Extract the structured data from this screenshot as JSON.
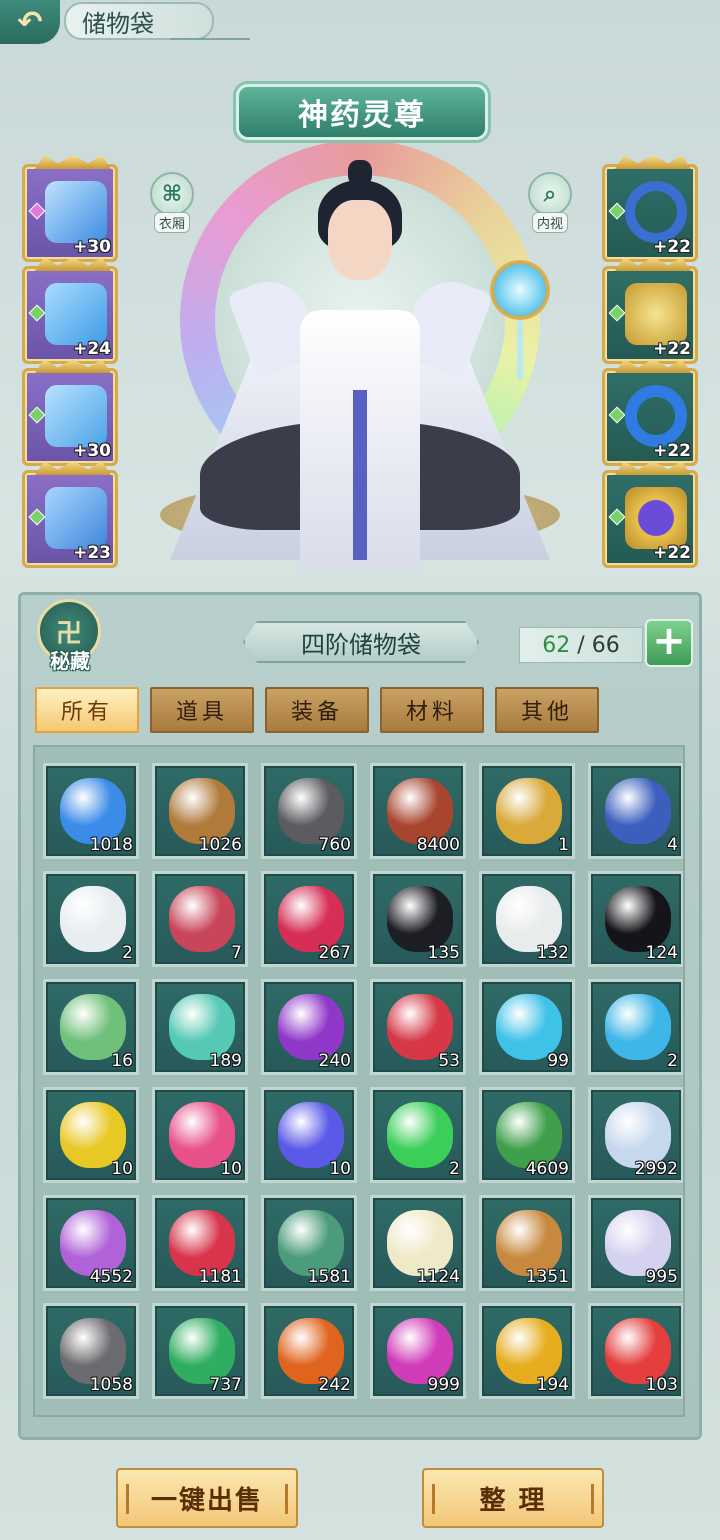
{
  "header": {
    "back_icon": "back-arrow-icon",
    "title": "储物袋"
  },
  "hero": {
    "title": "神药灵尊",
    "wardrobe_label": "衣厢",
    "inspect_label": "内视"
  },
  "equipment": {
    "left": [
      {
        "name": "sword",
        "level": "+30",
        "color": "#3d8ce0"
      },
      {
        "name": "armor",
        "level": "+24",
        "color": "#3e9be6"
      },
      {
        "name": "robe",
        "level": "+30",
        "color": "#4aa3e8"
      },
      {
        "name": "boots",
        "level": "+23",
        "color": "#3f86db"
      }
    ],
    "right": [
      {
        "name": "ring",
        "level": "+22",
        "color": "#3a6ed0"
      },
      {
        "name": "pendant",
        "level": "+22",
        "color": "#d2b449"
      },
      {
        "name": "bracelet",
        "level": "+22",
        "color": "#2f7be0"
      },
      {
        "name": "talisman",
        "level": "+22",
        "color": "#6a4cd8"
      }
    ]
  },
  "bag": {
    "secret_label": "秘藏",
    "title": "四阶储物袋",
    "used": "62",
    "sep": " / ",
    "capacity": "66",
    "plus_icon": "plus-icon",
    "tabs": [
      "所有",
      "道具",
      "装备",
      "材料",
      "其他"
    ],
    "items": [
      {
        "count": "1018",
        "color": "#3b8be8"
      },
      {
        "count": "1026",
        "color": "#b07a3a"
      },
      {
        "count": "760",
        "color": "#5b5b60"
      },
      {
        "count": "8400",
        "color": "#a8452f"
      },
      {
        "count": "1",
        "color": "#d9a93a"
      },
      {
        "count": "4",
        "color": "#3c5fbe"
      },
      {
        "count": "2",
        "color": "#e8eef0"
      },
      {
        "count": "7",
        "color": "#c9455a"
      },
      {
        "count": "267",
        "color": "#d62e55"
      },
      {
        "count": "135",
        "color": "#1d1d24"
      },
      {
        "count": "132",
        "color": "#e9ecec"
      },
      {
        "count": "124",
        "color": "#151519"
      },
      {
        "count": "16",
        "color": "#6fc07a"
      },
      {
        "count": "189",
        "color": "#55c9b4"
      },
      {
        "count": "240",
        "color": "#8f37c8"
      },
      {
        "count": "53",
        "color": "#d63848"
      },
      {
        "count": "99",
        "color": "#3fc2e8"
      },
      {
        "count": "2",
        "color": "#3fb6e8"
      },
      {
        "count": "10",
        "color": "#e8c825"
      },
      {
        "count": "10",
        "color": "#e8508a"
      },
      {
        "count": "10",
        "color": "#5b5ae8"
      },
      {
        "count": "2",
        "color": "#3bcf5a"
      },
      {
        "count": "4609",
        "color": "#3f9f4a"
      },
      {
        "count": "2992",
        "color": "#c7d8ee"
      },
      {
        "count": "4552",
        "color": "#b063d8"
      },
      {
        "count": "1181",
        "color": "#d8344c"
      },
      {
        "count": "1581",
        "color": "#4a9c7a"
      },
      {
        "count": "1124",
        "color": "#f0e9c8"
      },
      {
        "count": "1351",
        "color": "#c8893f"
      },
      {
        "count": "995",
        "color": "#d5d2f0"
      },
      {
        "count": "1058",
        "color": "#6c6c70"
      },
      {
        "count": "737",
        "color": "#2fae62"
      },
      {
        "count": "242",
        "color": "#e0631e"
      },
      {
        "count": "999",
        "color": "#d03bb8"
      },
      {
        "count": "194",
        "color": "#e6ad1e"
      },
      {
        "count": "103",
        "color": "#e53e3e"
      }
    ]
  },
  "actions": {
    "sell_all": "一键出售",
    "sort": "整 理"
  }
}
